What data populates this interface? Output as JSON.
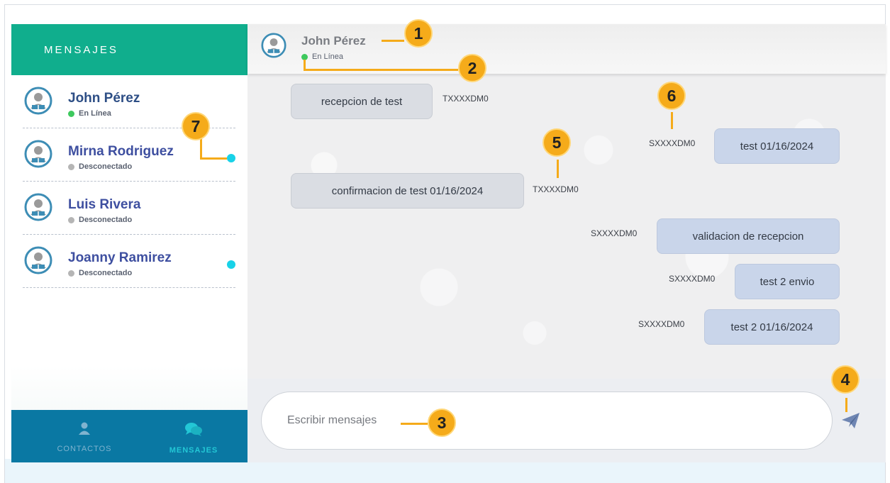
{
  "sidebar": {
    "title": "MENSAJES",
    "contacts": [
      {
        "name": "John Pérez",
        "status": "En Línea",
        "status_color": "#3ec95e",
        "unread": false
      },
      {
        "name": "Mirna Rodriguez",
        "status": "Desconectado",
        "status_color": "#b5b5b5",
        "unread": true
      },
      {
        "name": "Luis Rivera",
        "status": "Desconectado",
        "status_color": "#b5b5b5",
        "unread": false
      },
      {
        "name": "Joanny Ramirez",
        "status": "Desconectado",
        "status_color": "#b5b5b5",
        "unread": true
      }
    ],
    "tabs": [
      {
        "label": "CONTACTOS",
        "icon": "person-icon",
        "active": false
      },
      {
        "label": "MENSAJES",
        "icon": "chat-bubbles-icon",
        "active": true
      }
    ]
  },
  "chat": {
    "header": {
      "name": "John Pérez",
      "status": "En Línea"
    },
    "messages": [
      {
        "text": "recepcion de test",
        "code": "TXXXXDM0",
        "direction": "in"
      },
      {
        "text": "test 01/16/2024",
        "code": "SXXXXDM0",
        "direction": "out"
      },
      {
        "text": "confirmacion de test 01/16/2024",
        "code": "TXXXXDM0",
        "direction": "in"
      },
      {
        "text": "validacion de recepcion",
        "code": "SXXXXDM0",
        "direction": "out"
      },
      {
        "text": "test 2 envio",
        "code": "SXXXXDM0",
        "direction": "out"
      },
      {
        "text": "test 2 01/16/2024",
        "code": "SXXXXDM0",
        "direction": "out"
      }
    ],
    "input": {
      "placeholder": "Escribir mensajes",
      "value": ""
    },
    "send_icon": "paper-plane-icon"
  },
  "callouts": [
    "1",
    "2",
    "3",
    "4",
    "5",
    "6",
    "7"
  ],
  "colors": {
    "accent_green": "#10ae8d",
    "tabbar_blue": "#0a78a3",
    "online": "#3ec95e",
    "offline": "#b5b5b5",
    "unread": "#18d2e8",
    "callout": "#f5ab1a",
    "name_text": "#3e4fa0"
  }
}
